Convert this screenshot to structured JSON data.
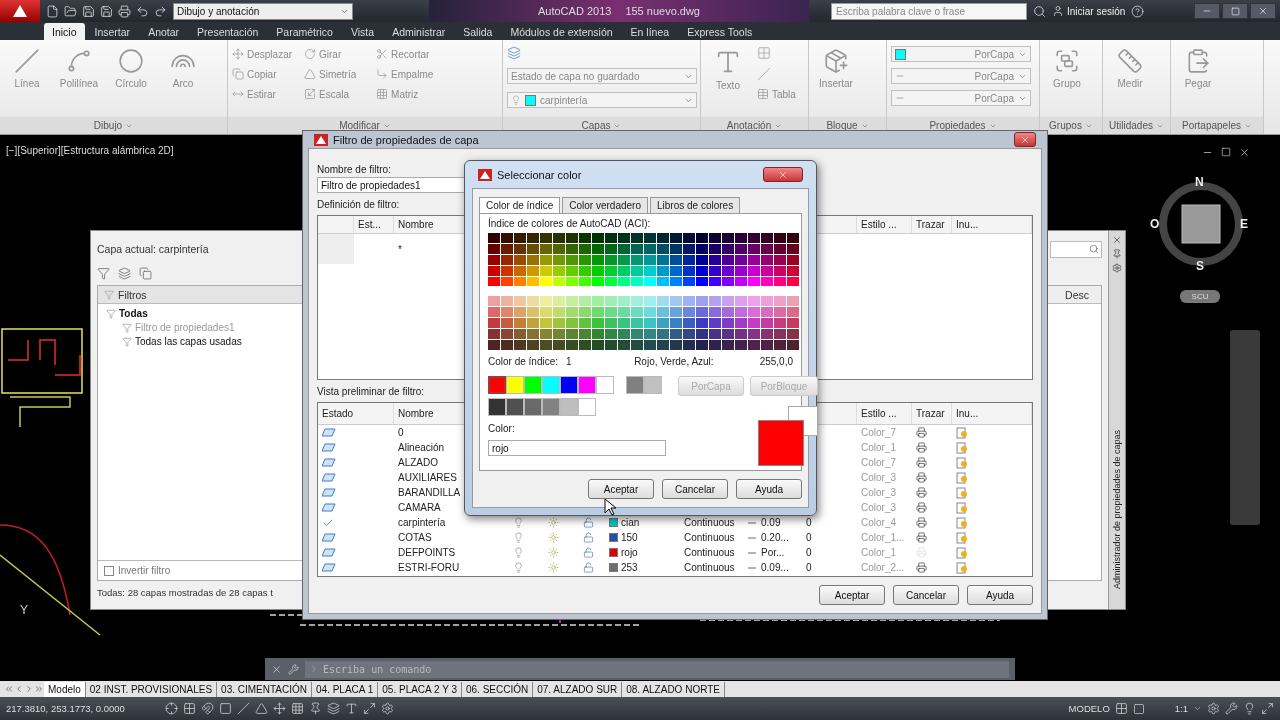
{
  "title_bar": {
    "workspace": "Dibujo y anotación",
    "title": "AutoCAD 2013",
    "file": "155 nuevo.dwg",
    "search": {
      "placeholder": "Escriba palabra clave o frase"
    },
    "sign_in": "Iniciar sesión"
  },
  "ribbon_tabs": [
    {
      "label": "Inicio",
      "selected": true
    },
    {
      "label": "Insertar",
      "selected": false
    },
    {
      "label": "Anotar",
      "selected": false
    },
    {
      "label": "Presentación",
      "selected": false
    },
    {
      "label": "Paramétrico",
      "selected": false
    },
    {
      "label": "Vista",
      "selected": false
    },
    {
      "label": "Administrar",
      "selected": false
    },
    {
      "label": "Salida",
      "selected": false
    },
    {
      "label": "Módulos de extensión",
      "selected": false
    },
    {
      "label": "En línea",
      "selected": false
    },
    {
      "label": "Express Tools",
      "selected": false
    }
  ],
  "ribbon_groups": [
    {
      "kind": "draw",
      "label": "Dibujo",
      "tools": [
        "Línea",
        "Polilínea",
        "Círculo",
        "Arco"
      ]
    },
    {
      "kind": "modify",
      "label": "Modificar",
      "tools": [
        "Desplazar",
        "Girar",
        "Recortar",
        "Copiar",
        "Simetría",
        "Empalme",
        "Estirar",
        "Escala",
        "Matriz"
      ]
    },
    {
      "kind": "layers",
      "label": "Capas",
      "layer_state": "Estado de capa no guardado",
      "current_layer": "carpintería"
    },
    {
      "kind": "annotation",
      "label": "Anotación",
      "big": "Texto",
      "small": "Tabla"
    },
    {
      "kind": "big",
      "label": "Bloque",
      "tool": "Insertar"
    },
    {
      "kind": "properties",
      "label": "Propiedades",
      "rows": [
        {
          "value": "PorCapa",
          "color": "#00ffff"
        },
        {
          "value": "PorCapa"
        },
        {
          "value": "PorCapa"
        }
      ]
    },
    {
      "kind": "big",
      "label": "Grupos",
      "tool": "Grupo"
    },
    {
      "kind": "big",
      "label": "Utilidades",
      "tool": "Medir"
    },
    {
      "kind": "big",
      "label": "Portapapeles",
      "tool": "Pegar"
    }
  ],
  "viewport": {
    "label": "[−][Superior][Estructura alámbrica 2D]",
    "ucs_label": "Y",
    "compass": {
      "north": "N",
      "east": "E",
      "south": "S",
      "west": "O"
    },
    "ucs_button": "SCU"
  },
  "layer_palette": {
    "current": "Capa actual: carpintería",
    "filters_header": "Filtros",
    "tree": [
      {
        "label": "Todas",
        "children": [
          {
            "label": "Filtro de propiedades1",
            "selected": true
          },
          {
            "label": "Todas las capas usadas",
            "selected": false
          }
        ]
      }
    ],
    "invert_filter": {
      "label": "Invertir filtro",
      "checked": false
    },
    "list_header": "Desc",
    "status": "Todas: 28 capas mostradas de 28 capas t",
    "side_title": "Administrador de propiedades de capas"
  },
  "filter_dialog": {
    "title": "Filtro de propiedades de capa",
    "name_label": "Nombre de filtro:",
    "name_value": "Filtro de propiedades1",
    "definition_label": "Definición de filtro:",
    "definition_header": {
      "status": "Est...",
      "name": "Nombre",
      "plot_style": "Estilo ...",
      "plot": "Trazar",
      "freeze": "Inu..."
    },
    "definition_rows": [
      {
        "name": "*"
      }
    ],
    "preview_label": "Vista preliminar de filtro:",
    "preview_header": {
      "status": "Estado",
      "name": "Nombre",
      "plot_style": "Estilo ...",
      "plot": "Trazar",
      "freeze": "Inu..."
    },
    "preview_rows": [
      {
        "name": "0",
        "current": false,
        "plot_style": "Color_7",
        "plot": true
      },
      {
        "name": "Alineación",
        "current": false,
        "plot_style": "Color_1",
        "plot": true
      },
      {
        "name": "ALZADO",
        "current": false,
        "plot_style": "Color_7",
        "plot": true
      },
      {
        "name": "AUXILIARES",
        "current": false,
        "plot_style": "Color_3",
        "plot": true
      },
      {
        "name": "BARANDILLA",
        "current": false,
        "plot_style": "Color_3",
        "plot": true
      },
      {
        "name": "CAMARA",
        "current": false,
        "plot_style": "Color_3",
        "plot": true
      },
      {
        "name": "carpintería",
        "current": true,
        "plot_style": "Color_4",
        "plot": true,
        "details": {
          "color": "#00c8c8",
          "color_label": "cian",
          "linetype": "Continuous",
          "lineweight": "0.09",
          "transparency": "0"
        }
      },
      {
        "name": "COTAS",
        "current": false,
        "plot_style": "Color_1...",
        "plot": true,
        "details": {
          "color": "#1f4fb0",
          "color_label": "150",
          "linetype": "Continuous",
          "lineweight": "0.20...",
          "transparency": "0"
        }
      },
      {
        "name": "DEFPOINTS",
        "current": false,
        "plot_style": "Color_1",
        "plot": false,
        "details": {
          "color": "#e00000",
          "color_label": "rojo",
          "linetype": "Continuous",
          "lineweight": "Por...",
          "transparency": "0"
        }
      },
      {
        "name": "ESTRI-FORU",
        "current": false,
        "plot_style": "Color_2...",
        "plot": true,
        "details": {
          "color": "#6e6e6e",
          "color_label": "253",
          "linetype": "Continuous",
          "lineweight": "0.09...",
          "transparency": "0"
        }
      }
    ],
    "buttons": [
      "Aceptar",
      "Cancelar",
      "Ayuda"
    ]
  },
  "color_dialog": {
    "title": "Seleccionar color",
    "tabs": [
      {
        "label": "Color de índice",
        "selected": true
      },
      {
        "label": "Color verdadero",
        "selected": false
      },
      {
        "label": "Libros de colores",
        "selected": false
      }
    ],
    "aci_label": "Índice de colores de AutoCAD (ACI):",
    "index_label": "Color de índice:",
    "index_value": "1",
    "rgb_label": "Rojo, Verde, Azul:",
    "rgb_value": "255,0,0",
    "standard_colors": [
      {
        "color": "#ff0000",
        "selected": true
      },
      {
        "color": "#ffff00",
        "selected": false
      },
      {
        "color": "#00ff00",
        "selected": false
      },
      {
        "color": "#00ffff",
        "selected": false
      },
      {
        "color": "#0000ff",
        "selected": false
      },
      {
        "color": "#ff00ff",
        "selected": false
      },
      {
        "color": "#ffffff",
        "selected": false
      }
    ],
    "gray_colors": [
      {
        "color": "#808080",
        "selected": false
      },
      {
        "color": "#c0c0c0",
        "selected": false
      }
    ],
    "gray_ramp": [
      {
        "color": "#333333",
        "selected": false
      },
      {
        "color": "#505050",
        "selected": false
      },
      {
        "color": "#696969",
        "selected": false
      },
      {
        "color": "#828282",
        "selected": false
      },
      {
        "color": "#bebebe",
        "selected": false
      },
      {
        "color": "#ffffff",
        "selected": false
      }
    ],
    "bylayer_button": {
      "label": "PorCapa",
      "disabled": true
    },
    "byblock_button": {
      "label": "PorBloque",
      "disabled": true
    },
    "color_label": "Color:",
    "color_value": "rojo",
    "buttons": [
      "Aceptar",
      "Cancelar",
      "Ayuda"
    ]
  },
  "command_line": {
    "placeholder": "Escriba un comando"
  },
  "layout_tabs": [
    {
      "label": "Modelo",
      "selected": true
    },
    {
      "label": "02 INST. PROVISIONALES",
      "selected": false
    },
    {
      "label": "03. CIMENTACIÓN",
      "selected": false
    },
    {
      "label": "04. PLACA 1",
      "selected": false
    },
    {
      "label": "05. PLACA 2 Y 3",
      "selected": false
    },
    {
      "label": "06. SECCIÓN",
      "selected": false
    },
    {
      "label": "07. ALZADO SUR",
      "selected": false
    },
    {
      "label": "08. ALZADO NORTE",
      "selected": false
    }
  ],
  "status_bar": {
    "coordinates": "217.3810, 253.1773, 0.0000",
    "space": "MODELO",
    "scale": "1:1"
  }
}
